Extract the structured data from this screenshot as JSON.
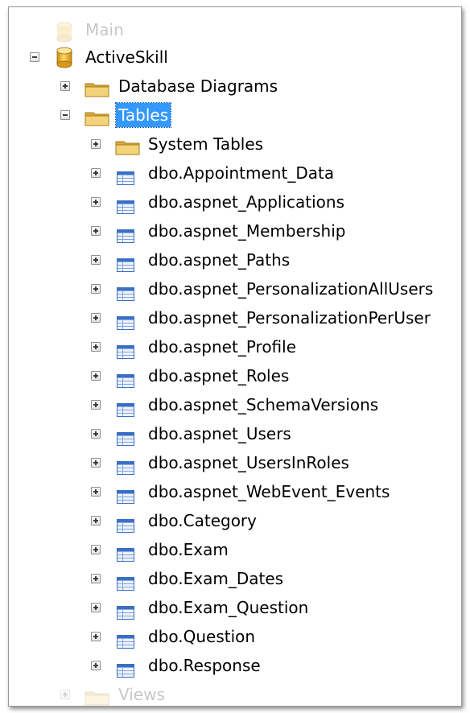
{
  "tree": {
    "top_partial_label": "Main",
    "database": {
      "label": "ActiveSkill",
      "icon": "database-cylinder-icon",
      "expanded": true
    },
    "database_diagrams": {
      "label": "Database Diagrams",
      "icon": "folder-icon",
      "expanded": false
    },
    "tables": {
      "label": "Tables",
      "icon": "folder-icon",
      "expanded": true,
      "selected": true
    },
    "system_tables": {
      "label": "System Tables",
      "icon": "folder-icon",
      "expanded": false
    },
    "table_items": [
      "dbo.Appointment_Data",
      "dbo.aspnet_Applications",
      "dbo.aspnet_Membership",
      "dbo.aspnet_Paths",
      "dbo.aspnet_PersonalizationAllUsers",
      "dbo.aspnet_PersonalizationPerUser",
      "dbo.aspnet_Profile",
      "dbo.aspnet_Roles",
      "dbo.aspnet_SchemaVersions",
      "dbo.aspnet_Users",
      "dbo.aspnet_UsersInRoles",
      "dbo.aspnet_WebEvent_Events",
      "dbo.Category",
      "dbo.Exam",
      "dbo.Exam_Dates",
      "dbo.Exam_Question",
      "dbo.Question",
      "dbo.Response"
    ],
    "views": {
      "label": "Views",
      "icon": "folder-icon"
    }
  },
  "colors": {
    "selection": "#3399ff",
    "folder": "#e8c05a",
    "table_icon": "#3a6fc4",
    "database_icon": "#e0a020"
  }
}
